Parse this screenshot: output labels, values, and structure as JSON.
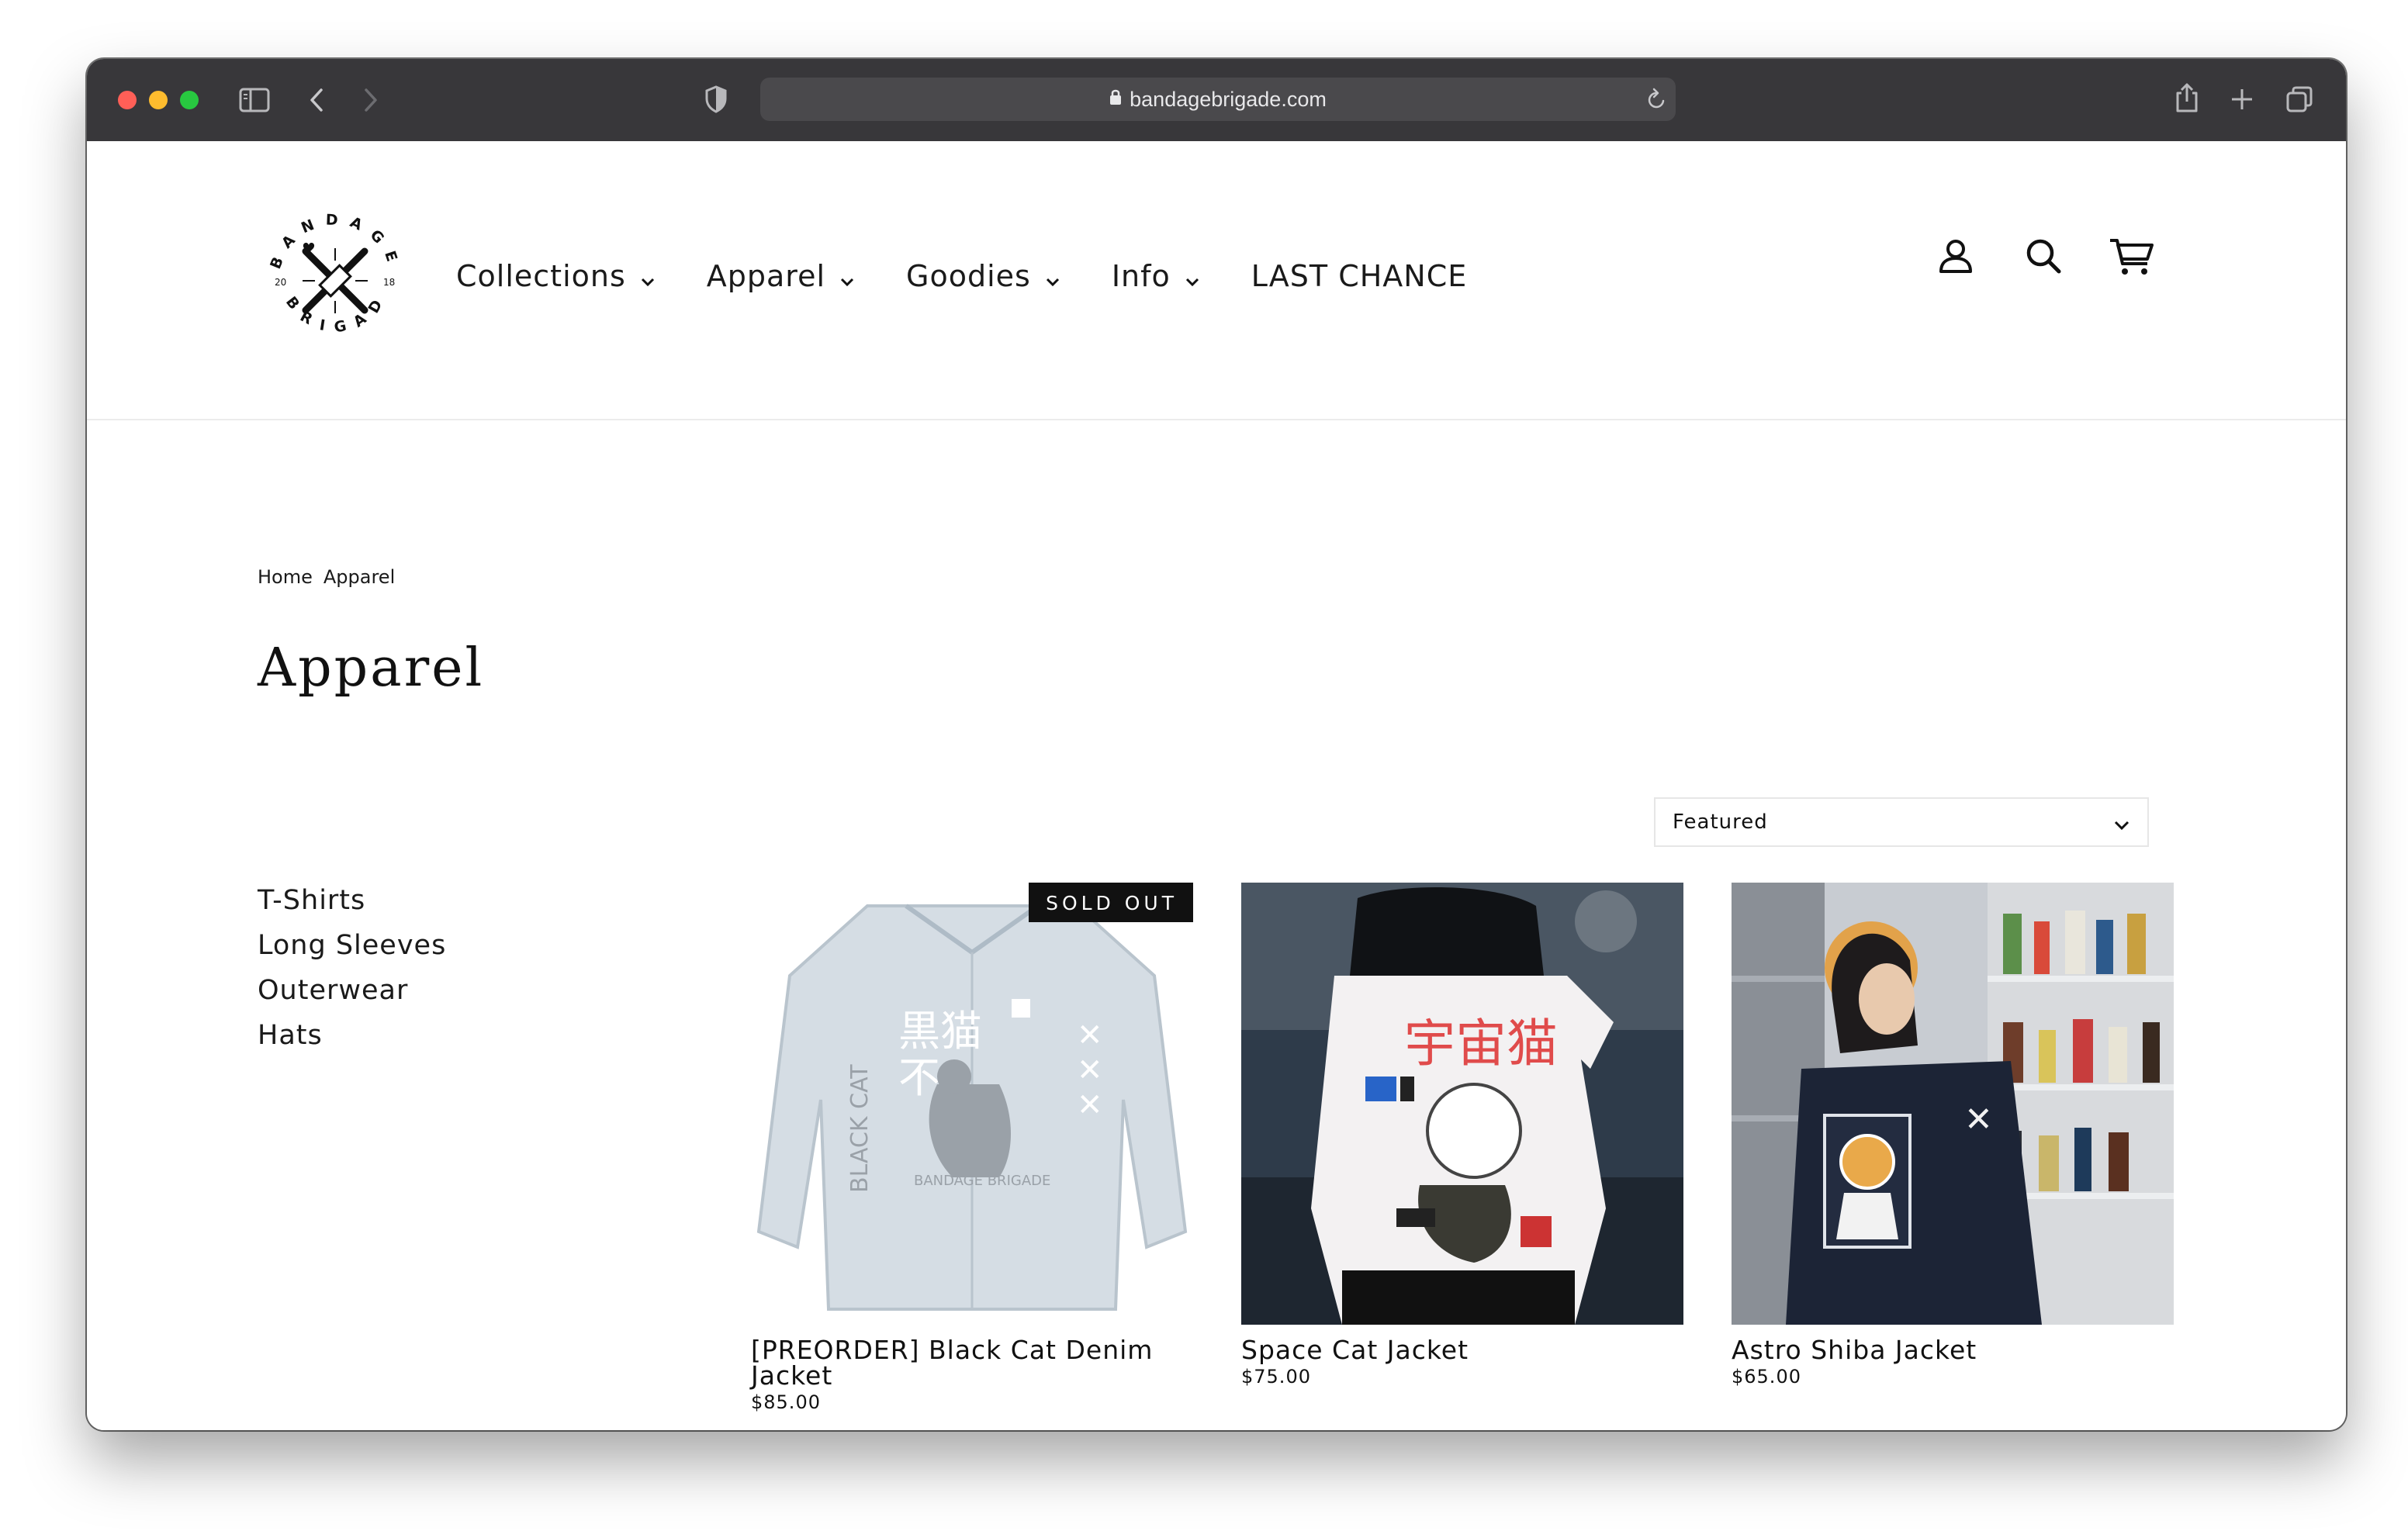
{
  "browser": {
    "url": "bandagebrigade.com"
  },
  "header": {
    "logo_text": "BANDAGE BRIGADE 2018",
    "nav": [
      {
        "label": "Collections",
        "has_dropdown": true
      },
      {
        "label": "Apparel",
        "has_dropdown": true
      },
      {
        "label": "Goodies",
        "has_dropdown": true
      },
      {
        "label": "Info",
        "has_dropdown": true
      },
      {
        "label": "LAST CHANCE",
        "has_dropdown": false
      }
    ],
    "icons": [
      "account-icon",
      "search-icon",
      "cart-icon"
    ]
  },
  "breadcrumb": [
    "Home",
    "Apparel"
  ],
  "page_title": "Apparel",
  "sort": {
    "selected": "Featured"
  },
  "sidebar": {
    "links": [
      "T-Shirts",
      "Long Sleeves",
      "Outerwear",
      "Hats"
    ]
  },
  "products": [
    {
      "name": "[PREORDER] Black Cat Denim Jacket",
      "price": "$85.00",
      "badge": "SOLD OUT"
    },
    {
      "name": "Space Cat Jacket",
      "price": "$75.00"
    },
    {
      "name": "Astro Shiba Jacket",
      "price": "$65.00"
    }
  ],
  "colors": {
    "titlebar": "#38373a",
    "text": "#111111",
    "badge_bg": "#111111"
  }
}
